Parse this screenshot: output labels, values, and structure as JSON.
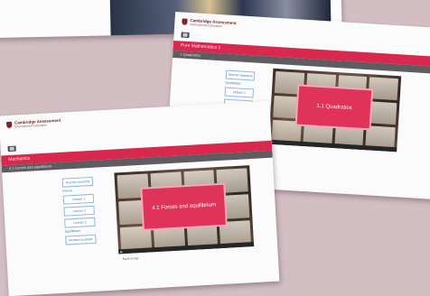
{
  "top_card": {},
  "back_card": {
    "logo": {
      "line1": "Cambridge Assessment",
      "line2": "International Education"
    },
    "course_title": "Pure Mathematics 1",
    "section": "1 Quadratics",
    "nav": {
      "first_button": "Teacher sessions",
      "group1_label": "Quadratics",
      "group1_buttons": [
        "Lesson 1",
        "Lesson 2"
      ]
    },
    "video_title": "1.1 Quadratics"
  },
  "front_card": {
    "logo": {
      "line1": "Cambridge Assessment",
      "line2": "International Education"
    },
    "course_title": "Mechanics",
    "section": "4.1 Forces and equilibrium",
    "nav": {
      "first_button": "Teacher sessions",
      "group1_label": "Forces",
      "group1_buttons": [
        "Lesson 1",
        "Lesson 2",
        "Lesson 3"
      ],
      "group2_label": "Equilibrium",
      "group2_buttons": [
        "Worked example"
      ]
    },
    "video_title": "4.1 Forces and equilibrium",
    "below_video": "Back to top"
  }
}
